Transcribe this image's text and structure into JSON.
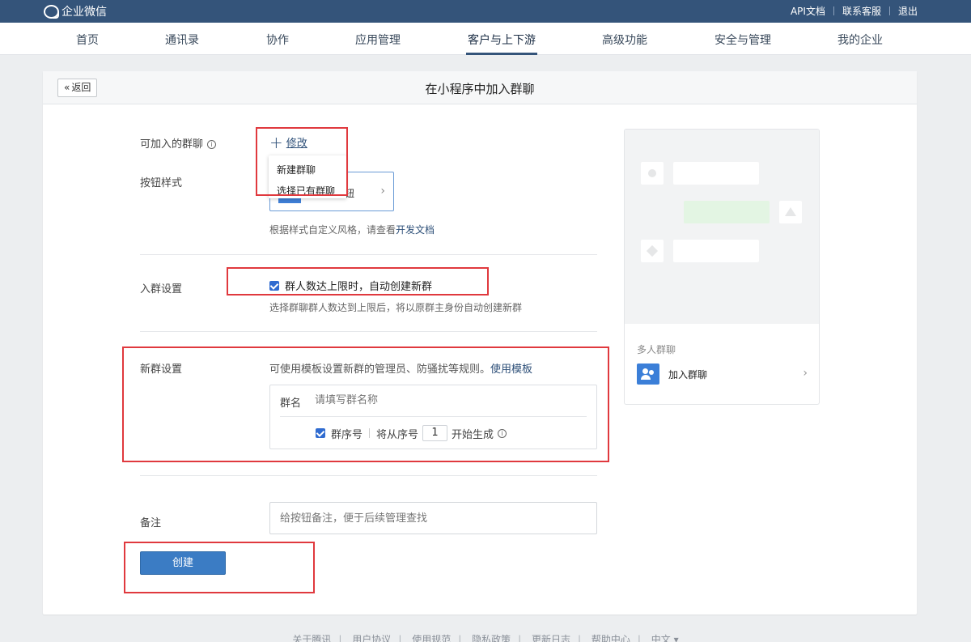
{
  "topbar": {
    "logo_text": "企业微信",
    "links": [
      "API文档",
      "联系客服",
      "退出"
    ]
  },
  "nav": {
    "items": [
      "首页",
      "通讯录",
      "协作",
      "应用管理",
      "客户与上下游",
      "高级功能",
      "安全与管理",
      "我的企业"
    ],
    "active_index": 4
  },
  "panel": {
    "back_label": "返回",
    "title": "在小程序中加入群聊"
  },
  "form": {
    "joinable_group_label": "可加入的群聊",
    "modify_label": "修改",
    "dropdown_items": [
      "新建群聊",
      "选择已有群聊"
    ],
    "button_style_label": "按钮样式",
    "button_style_tail": "钮",
    "style_hint_prefix": "根据样式自定义风格，请查看",
    "style_hint_link": "开发文档",
    "join_settings_label": "入群设置",
    "auto_create_label": "群人数达上限时，自动创建新群",
    "auto_create_checked": true,
    "auto_create_hint": "选择群聊群人数达到上限后，将以原群主身份自动创建新群",
    "new_group_label": "新群设置",
    "new_group_hint": "可使用模板设置新群的管理员、防骚扰等规则。",
    "use_template_link": "使用模板",
    "group_name_label": "群名",
    "group_name_placeholder": "请填写群名称",
    "group_serial_label": "群序号",
    "group_serial_checked": true,
    "serial_start_prefix": "将从序号",
    "serial_start_value": "1",
    "serial_start_suffix": "开始生成",
    "remark_label": "备注",
    "remark_placeholder": "给按钮备注，便于后续管理查找",
    "create_button": "创建"
  },
  "preview": {
    "section_title": "多人群聊",
    "card_label": "加入群聊"
  },
  "footer": {
    "links": [
      "关于腾讯",
      "用户协议",
      "使用规范",
      "隐私政策",
      "更新日志",
      "帮助中心",
      "中文 ▾"
    ]
  },
  "colors": {
    "topbar": "#34547a",
    "accent_blue": "#3b7cc4",
    "link": "#2d4f78",
    "annotation_red": "#e0393e",
    "bubble_green": "#e3f5e3"
  }
}
